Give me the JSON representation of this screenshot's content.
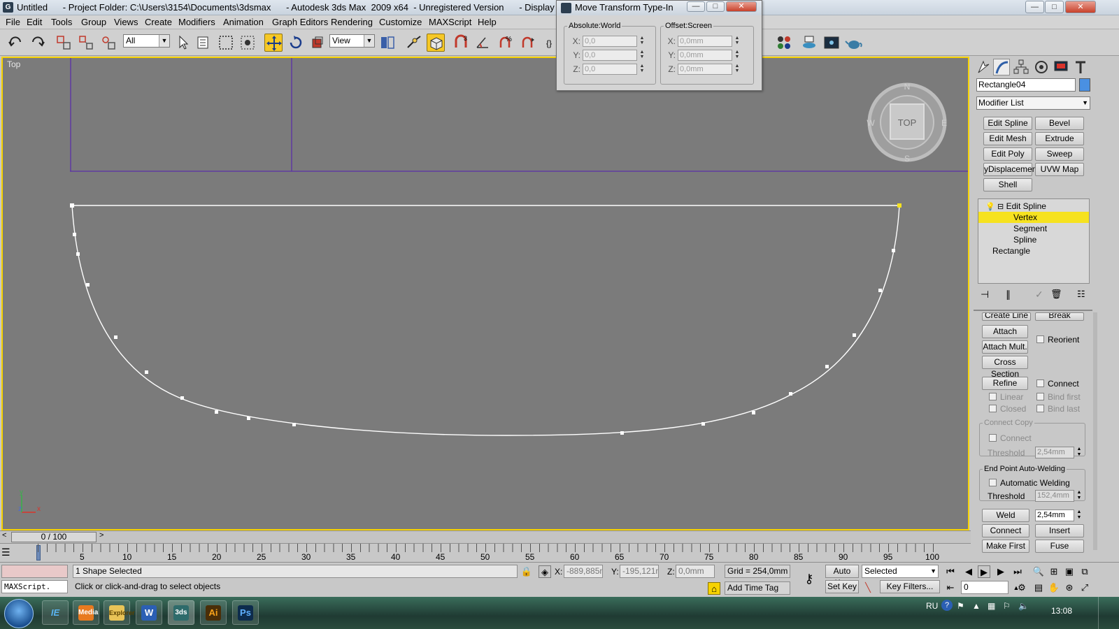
{
  "window": {
    "title": "Untitled      - Project Folder: C:\\Users\\3154\\Documents\\3dsmax      - Autodesk 3ds Max  2009 x64  - Unregistered Version      - Display : Direct 3D",
    "controls": {
      "minimize": "—",
      "maximize": "□",
      "close": "✕"
    }
  },
  "menu": [
    "File",
    "Edit",
    "Tools",
    "Group",
    "Views",
    "Create",
    "Modifiers",
    "Animation",
    "Graph Editors",
    "Rendering",
    "Customize",
    "MAXScript",
    "Help"
  ],
  "toolbar": {
    "selection_filter": "All",
    "reference_coord": "View"
  },
  "viewport": {
    "label": "Top",
    "viewcube_label": "TOP",
    "compass": {
      "n": "N",
      "s": "S",
      "e": "E",
      "w": "W"
    },
    "axis": {
      "x": "x",
      "y": "y",
      "z": "z"
    }
  },
  "move_dialog": {
    "title": "Move Transform Type-In",
    "absolute": {
      "legend": "Absolute:World",
      "rows": [
        {
          "axis": "X:",
          "value": "0,0"
        },
        {
          "axis": "Y:",
          "value": "0,0"
        },
        {
          "axis": "Z:",
          "value": "0,0"
        }
      ]
    },
    "offset": {
      "legend": "Offset:Screen",
      "rows": [
        {
          "axis": "X:",
          "value": "0,0mm"
        },
        {
          "axis": "Y:",
          "value": "0,0mm"
        },
        {
          "axis": "Z:",
          "value": "0,0mm"
        }
      ]
    }
  },
  "command_panel": {
    "object_name": "Rectangle04",
    "object_color": "#4a90e2",
    "modifier_list": "Modifier List",
    "modifier_buttons": [
      "Edit Spline",
      "Bevel",
      "Edit Mesh",
      "Extrude",
      "Edit Poly",
      "Sweep",
      "yDisplacement",
      "UVW Map",
      "Shell"
    ],
    "stack": {
      "items": [
        "Edit Spline",
        "Vertex",
        "Segment",
        "Spline",
        "Rectangle"
      ],
      "selected": "Vertex"
    },
    "geometry": {
      "cut_top": "Create Line",
      "cut_top_right": "Break",
      "attach": "Attach",
      "reorient": "Reorient",
      "attach_mult": "Attach Mult.",
      "cross_section": "Cross Section",
      "refine": "Refine",
      "connect": "Connect",
      "linear": "Linear",
      "bind_first": "Bind first",
      "closed": "Closed",
      "bind_last": "Bind last",
      "connect_copy_title": "Connect Copy",
      "connect_copy_connect": "Connect",
      "threshold_label": "Threshold",
      "threshold_value": "2,54mm",
      "autoweld_title": "End Point Auto-Welding",
      "automatic_welding": "Automatic Welding",
      "autoweld_threshold_label": "Threshold",
      "autoweld_threshold_value": "152,4mm",
      "weld": "Weld",
      "weld_value": "2,54mm",
      "connect_btn": "Connect",
      "insert": "Insert",
      "make_first": "Make First",
      "fuse": "Fuse"
    }
  },
  "timeline": {
    "slider": "0 / 100",
    "prev": "<",
    "next": ">",
    "ticks": [
      "5",
      "10",
      "15",
      "20",
      "25",
      "30",
      "35",
      "40",
      "45",
      "50",
      "55",
      "60",
      "65",
      "70",
      "75",
      "80",
      "85",
      "90",
      "95",
      "100"
    ]
  },
  "status": {
    "maxscript": "MAXScript.",
    "selection_info": "1 Shape Selected",
    "prompt": "Click or click-and-drag to select objects",
    "x_label": "X:",
    "x_value": "-889,885mm",
    "y_label": "Y:",
    "y_value": "-195,121mm",
    "z_label": "Z:",
    "z_value": "0,0mm",
    "grid": "Grid = 254,0mm",
    "add_time_tag": "Add Time Tag",
    "auto_key": "Auto Key",
    "set_key": "Set Key",
    "selected_dropdown": "Selected",
    "key_filters": "Key Filters...",
    "frame_value": "0"
  },
  "taskbar": {
    "apps": [
      "IE",
      "Media",
      "Explorer",
      "W",
      "3ds",
      "Ai",
      "Ps"
    ],
    "language": "RU",
    "clock": "13:08"
  }
}
